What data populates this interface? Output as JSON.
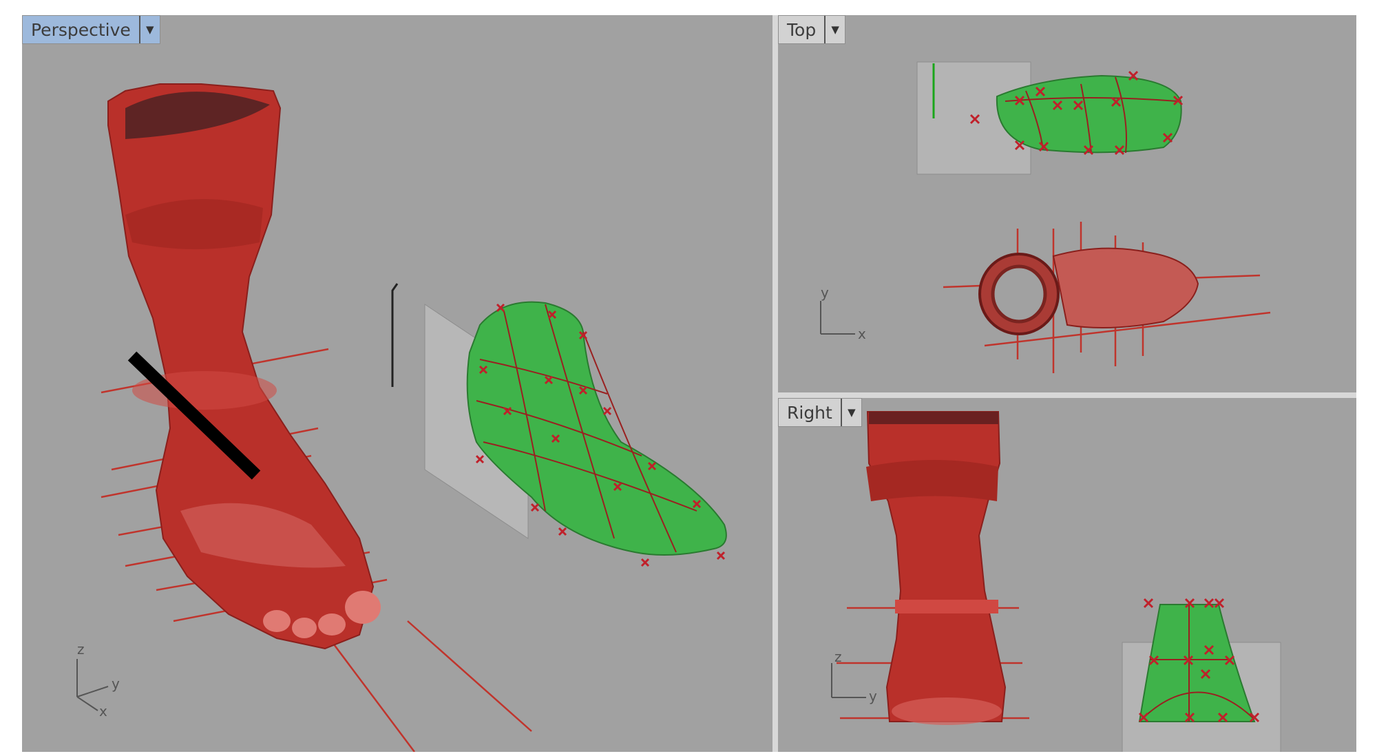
{
  "viewports": {
    "perspective": {
      "label": "Perspective",
      "axes": {
        "z": "z",
        "y": "y",
        "x": "x"
      }
    },
    "top": {
      "label": "Top",
      "axes": {
        "y": "y",
        "x": "x"
      }
    },
    "right": {
      "label": "Right",
      "axes": {
        "z": "z",
        "y": "y"
      }
    }
  },
  "icons": {
    "dropdown": "chevron-down-icon"
  },
  "colors": {
    "viewport_bg": "#a1a1a1",
    "active_tab": "#9db9dc",
    "mesh_red": "#c0342c",
    "surface_green": "#3fb34a",
    "control_point": "#c0202a"
  }
}
